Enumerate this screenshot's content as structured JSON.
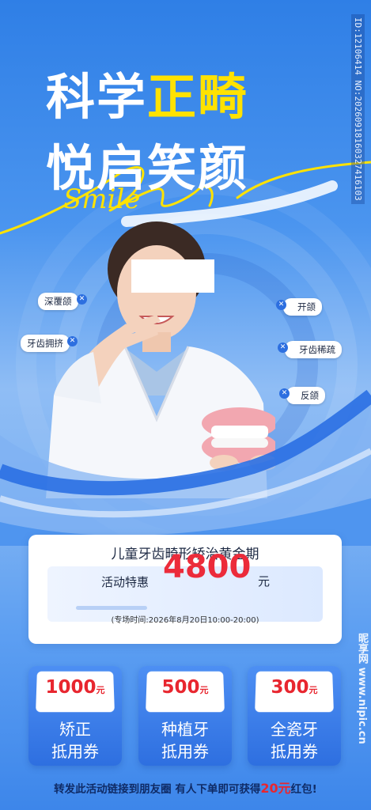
{
  "headline": {
    "line1_white": "科学",
    "line1_yellow": "正畸",
    "line2": "悦启笑颜",
    "script_word": "Smile"
  },
  "side_id": "ID:12106414 NO:20260918160327416103",
  "tags": {
    "deep_overbite": "深覆颌",
    "crowding": "牙齿拥挤",
    "open_bite": "开颌",
    "spacing": "牙齿稀疏",
    "underbite": "反颌"
  },
  "tag_icon": "close-icon",
  "card": {
    "title": "儿童牙齿畸形矫治黄金期",
    "promo_label": "活动特惠",
    "price": "4800",
    "price_unit": "元",
    "time_text": "(专场时间:2026年8月20日10:00-20:00)"
  },
  "coupons": [
    {
      "amount": "1000",
      "unit": "元",
      "line1": "矫正",
      "line2": "抵用券"
    },
    {
      "amount": "500",
      "unit": "元",
      "line1": "种植牙",
      "line2": "抵用券"
    },
    {
      "amount": "300",
      "unit": "元",
      "line1": "全瓷牙",
      "line2": "抵用券"
    }
  ],
  "footer": {
    "prefix": "转发此活动链接到朋友圈 有人下单即可获得",
    "highlight": "20元",
    "suffix": "红包!"
  },
  "watermark": "昵享网 www.nipic.cn",
  "colors": {
    "accent_yellow": "#ffe200",
    "price_red": "#ec2b3a",
    "primary_blue": "#2e6fe0"
  }
}
